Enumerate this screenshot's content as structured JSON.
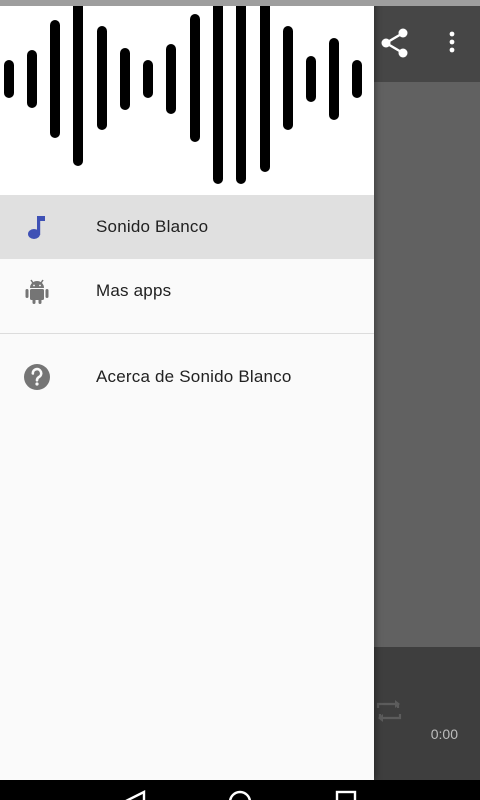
{
  "app": {
    "time_label": "0:00"
  },
  "drawer": {
    "header_icon": "sound-wave-logo",
    "items": [
      {
        "label": "Sonido Blanco",
        "icon": "music-note-icon",
        "selected": true
      },
      {
        "label": "Mas apps",
        "icon": "android-icon",
        "selected": false
      },
      {
        "label": "Acerca de Sonido Blanco",
        "icon": "help-circle-icon",
        "selected": false
      }
    ]
  },
  "colors": {
    "accent": "#3f51b5",
    "icon_grey": "#757575",
    "selected_bg": "#e0e0e0"
  }
}
